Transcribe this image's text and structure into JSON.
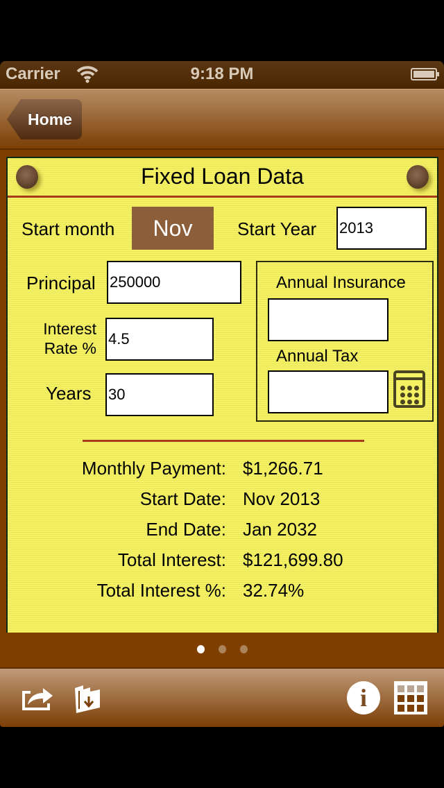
{
  "status_bar": {
    "carrier": "Carrier",
    "time": "9:18 PM",
    "wifi_icon": "wifi-icon",
    "battery_icon": "battery-icon"
  },
  "nav_bar": {
    "back_label": "Home"
  },
  "page": {
    "title": "Fixed Loan Data",
    "form": {
      "start_month_label": "Start month",
      "start_month_value": "Nov",
      "start_year_label": "Start Year",
      "start_year_value": "2013",
      "principal_label": "Principal",
      "principal_value": "250000",
      "interest_label_line1": "Interest",
      "interest_label_line2": "Rate %",
      "interest_value": "4.5",
      "years_label": "Years",
      "years_value": "30",
      "insurance_label": "Annual Insurance",
      "insurance_value": "",
      "tax_label": "Annual Tax",
      "tax_value": ""
    },
    "results": [
      {
        "label": "Monthly Payment:",
        "value": "$1,266.71"
      },
      {
        "label": "Start Date:",
        "value": "Nov 2013"
      },
      {
        "label": "End Date:",
        "value": "Jan 2032"
      },
      {
        "label": "Total Interest:",
        "value": "$121,699.80"
      },
      {
        "label": "Total Interest %:",
        "value": "32.74%"
      }
    ]
  },
  "page_control": {
    "pages": 3,
    "current": 1
  },
  "toolbar": {
    "items": [
      "share-icon",
      "import-icon",
      "info-icon",
      "grid-icon"
    ]
  },
  "colors": {
    "wood": "#7e3f00",
    "paper": "#f5f164",
    "month_button": "#8c5f3a",
    "rule": "#a83a1c"
  }
}
